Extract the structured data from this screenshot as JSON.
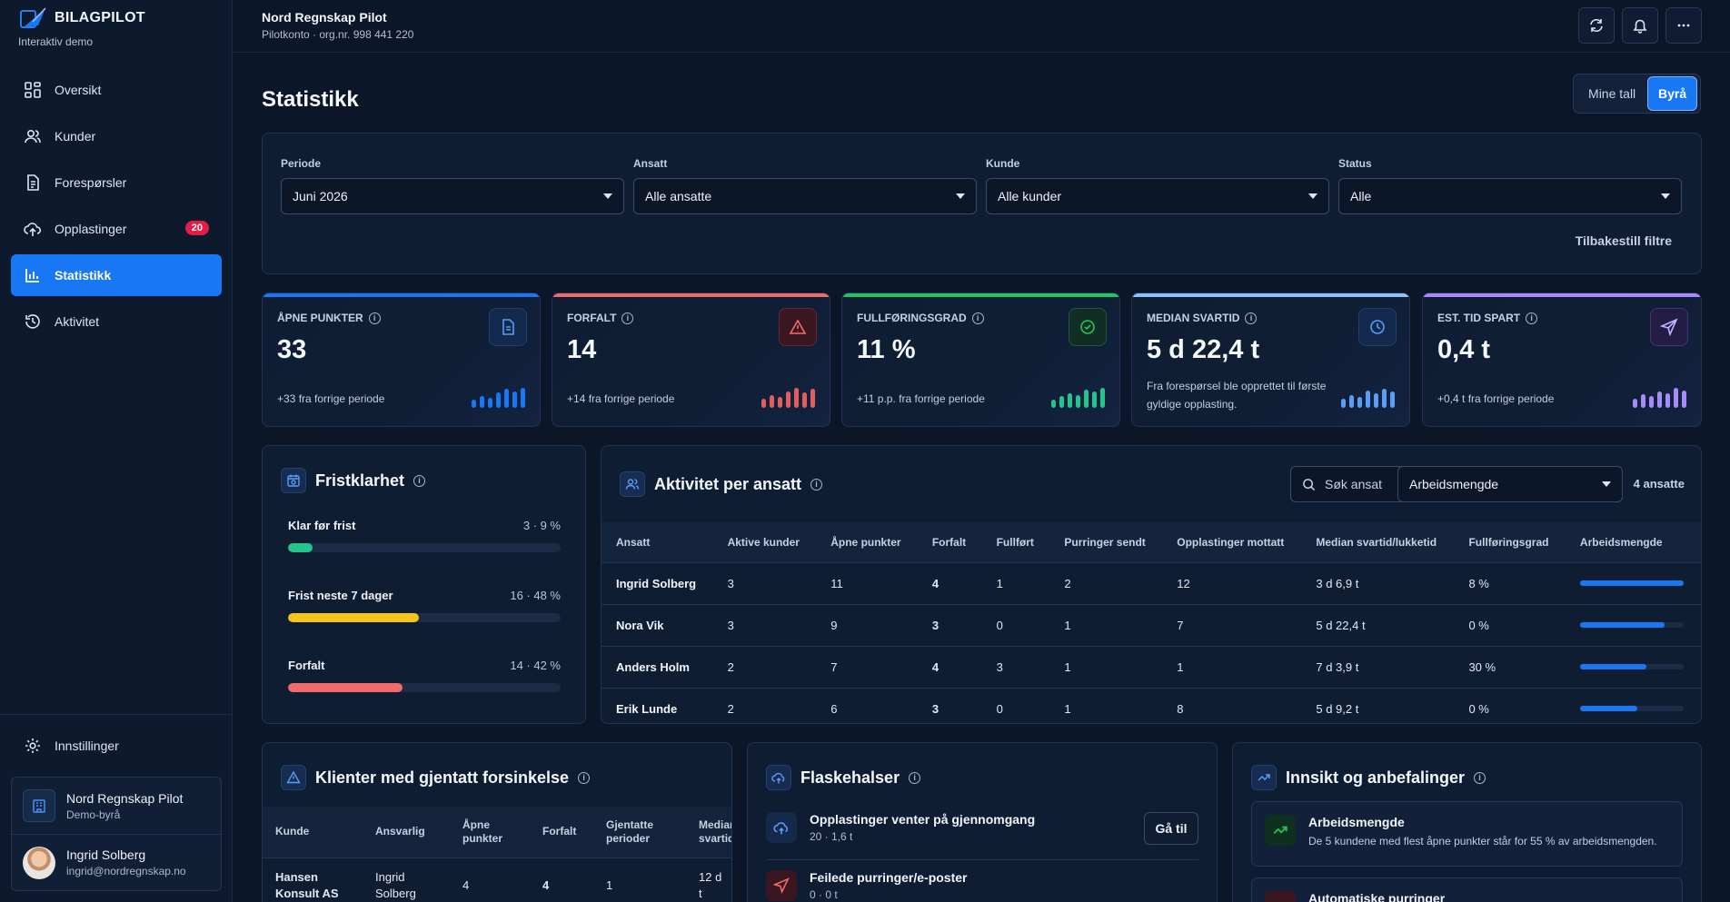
{
  "brand": {
    "name": "BILAGPILOT",
    "subtitle": "Interaktiv demo"
  },
  "nav": [
    {
      "label": "Oversikt",
      "icon": "grid-icon"
    },
    {
      "label": "Kunder",
      "icon": "users-icon"
    },
    {
      "label": "Forespørsler",
      "icon": "document-icon"
    },
    {
      "label": "Opplastinger",
      "icon": "upload-icon",
      "badge": "20"
    },
    {
      "label": "Statistikk",
      "icon": "bar-chart-icon",
      "active": true
    },
    {
      "label": "Aktivitet",
      "icon": "history-icon"
    }
  ],
  "settings_label": "Innstillinger",
  "account": {
    "org_name": "Nord Regnskap Pilot",
    "org_sub": "Demo-byrå",
    "user_name": "Ingrid Solberg",
    "user_email": "ingrid@nordregnskap.no"
  },
  "header": {
    "org_name": "Nord Regnskap Pilot",
    "org_sub": "Pilotkonto · org.nr. 998 441 220"
  },
  "page_title": "Statistikk",
  "view_toggle": {
    "option_mine": "Mine tall",
    "option_byra": "Byrå",
    "selected": "Byrå"
  },
  "filters": {
    "periode": {
      "label": "Periode",
      "value": "Juni 2026"
    },
    "ansatt": {
      "label": "Ansatt",
      "value": "Alle ansatte"
    },
    "kunde": {
      "label": "Kunde",
      "value": "Alle kunder"
    },
    "status": {
      "label": "Status",
      "value": "Alle"
    },
    "reset_label": "Tilbakestill filtre"
  },
  "kpis": [
    {
      "label": "ÅPNE PUNKTER",
      "value": "33",
      "foot": "+33 fra forrige periode",
      "color": "#1877f2"
    },
    {
      "label": "FORFALT",
      "value": "14",
      "foot": "+14 fra forrige periode",
      "color": "#f26b6b"
    },
    {
      "label": "FULLFØRINGSGRAD",
      "value": "11 %",
      "foot": "+11 p.p. fra forrige periode",
      "color": "#22c55e"
    },
    {
      "label": "MEDIAN SVARTID",
      "value": "5 d 22,4 t",
      "foot": "Fra forespørsel ble opprettet til første gyldige opplasting.",
      "color": "#60a5fa"
    },
    {
      "label": "EST. TID SPART",
      "value": "0,4 t",
      "foot": "+0,4 t fra forrige periode",
      "color": "#a78bfa"
    }
  ],
  "fristklarhet": {
    "title": "Fristklarhet",
    "rows": [
      {
        "name": "Klar før frist",
        "value": "3 · 9 %",
        "percent": 9,
        "color": "#22c58b"
      },
      {
        "name": "Frist neste 7 dager",
        "value": "16 · 48 %",
        "percent": 48,
        "color": "#f5c518"
      },
      {
        "name": "Forfalt",
        "value": "14 · 42 %",
        "percent": 42,
        "color": "#f26b6b"
      }
    ]
  },
  "activity": {
    "title": "Aktivitet per ansatt",
    "search_placeholder": "Søk ansat",
    "sort_select": "Arbeidsmengde",
    "count": "4 ansatte",
    "columns": [
      "Ansatt",
      "Aktive kunder",
      "Åpne punkter",
      "Forfalt",
      "Fullført",
      "Purringer sendt",
      "Opplastinger mottatt",
      "Median svartid/lukketid",
      "Fullføringsgrad",
      "Arbeidsmengde"
    ],
    "rows": [
      {
        "name": "Ingrid Solberg",
        "aktive": "3",
        "apne": "11",
        "forfalt": "4",
        "fullfort": "1",
        "purringer": "2",
        "opplastinger": "12",
        "median": "3 d 6,9 t",
        "grad": "8 %",
        "workload": 1.0
      },
      {
        "name": "Nora Vik",
        "aktive": "3",
        "apne": "9",
        "forfalt": "3",
        "fullfort": "0",
        "purringer": "1",
        "opplastinger": "7",
        "median": "5 d 22,4 t",
        "grad": "0 %",
        "workload": 0.82
      },
      {
        "name": "Anders Holm",
        "aktive": "2",
        "apne": "7",
        "forfalt": "4",
        "fullfort": "3",
        "purringer": "1",
        "opplastinger": "1",
        "median": "7 d 3,9 t",
        "grad": "30 %",
        "workload": 0.64
      },
      {
        "name": "Erik Lunde",
        "aktive": "2",
        "apne": "6",
        "forfalt": "3",
        "fullfort": "0",
        "purringer": "1",
        "opplastinger": "8",
        "median": "5 d 9,2 t",
        "grad": "0 %",
        "workload": 0.55
      }
    ]
  },
  "klienter": {
    "title": "Klienter med gjentatt forsinkelse",
    "columns": {
      "kunde": "Kunde",
      "ansvarlig": "Ansvarlig",
      "apne_1": "Åpne",
      "apne_2": "punkter",
      "forfalt": "Forfalt",
      "gjentatte_1": "Gjentatte",
      "gjentatte_2": "perioder",
      "median_1": "Median",
      "median_2": "svartid"
    },
    "row": {
      "kunde_1": "Hansen",
      "kunde_2": "Konsult AS",
      "ansvarlig_1": "Ingrid",
      "ansvarlig_2": "Solberg",
      "apne": "4",
      "forfalt": "4",
      "gjentatte": "1",
      "median_1": "12 d",
      "median_2": "t"
    }
  },
  "flaskehalser": {
    "title": "Flaskehalser",
    "items": [
      {
        "title": "Opplastinger venter på gjennomgang",
        "sub": "20 · 1,6 t"
      },
      {
        "title": "Feilede purringer/e-poster",
        "sub": "0 · 0 t"
      }
    ],
    "goto_label": "Gå til"
  },
  "innsikt": {
    "title": "Innsikt og anbefalinger",
    "items": [
      {
        "title": "Arbeidsmengde",
        "sub": "De 5 kundene med flest åpne punkter står for 55 % av arbeidsmengden."
      },
      {
        "title": "Automatiske purringer",
        "sub": ""
      }
    ]
  }
}
